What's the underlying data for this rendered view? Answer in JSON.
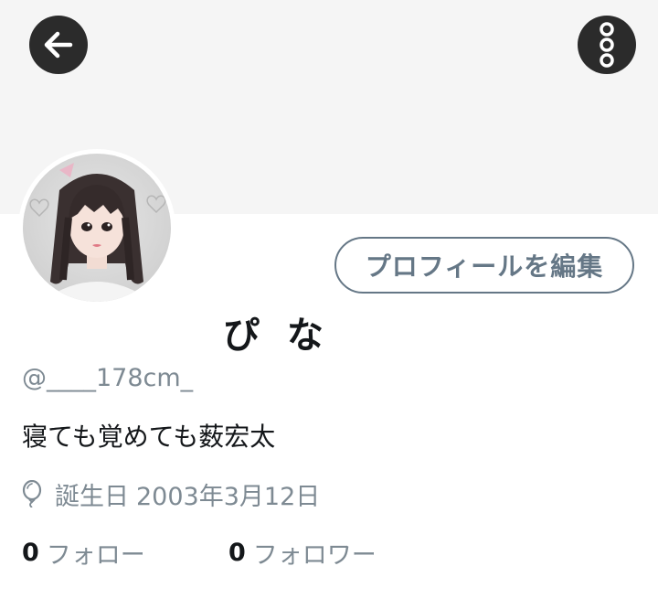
{
  "theme": {
    "banner_bg": "#f5f5f5",
    "icon_button_bg": "#2b2b2b",
    "secondary_text": "#7e8a93",
    "primary_text": "#14171a",
    "outline_button": "#657786"
  },
  "header": {
    "back_icon": "arrow-left-icon",
    "menu_icon": "vertical-dots-icon"
  },
  "profile": {
    "avatar_icon": "profile-photo",
    "edit_button_label": "プロフィールを編集",
    "display_name": "ぴ な",
    "handle": "@____178cm_",
    "bio": "寝ても覚めても薮宏太",
    "birthday_icon": "balloon-icon",
    "birthday_label": "誕生日",
    "birthday_value": "2003年3月12日"
  },
  "stats": {
    "following_count": "0",
    "following_label": "フォロー",
    "followers_count": "0",
    "followers_label": "フォロワー"
  }
}
